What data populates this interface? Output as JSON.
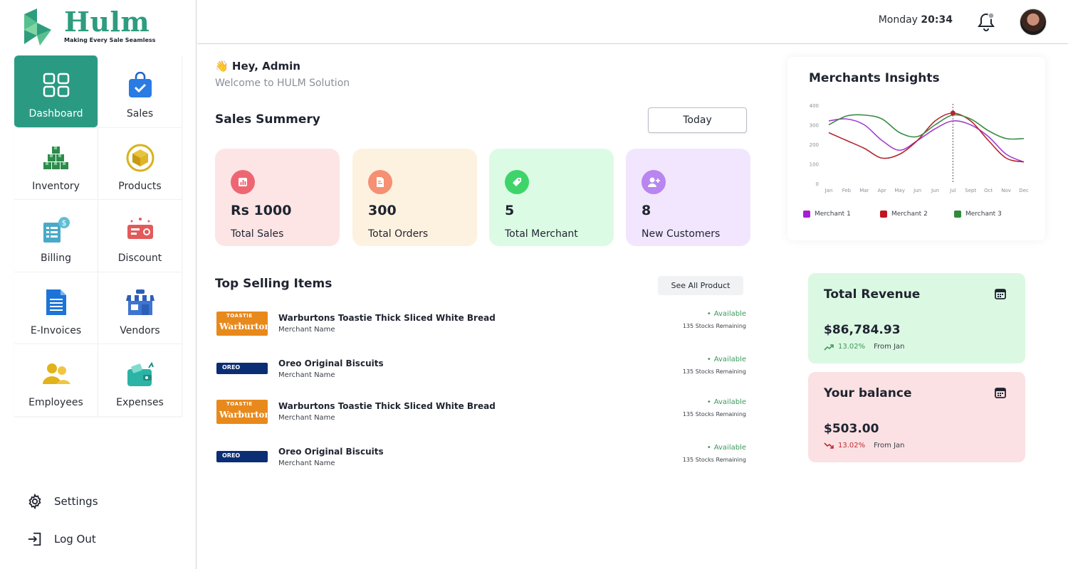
{
  "brand": {
    "name": "Hulm",
    "tagline": "Making Every Sale Seamless",
    "color": "#2d9c7f"
  },
  "sidebar": {
    "items": [
      {
        "label": "Dashboard",
        "icon": "dashboard-grid-icon",
        "active": true
      },
      {
        "label": "Sales",
        "icon": "shopping-bag-icon"
      },
      {
        "label": "Inventory",
        "icon": "boxes-icon"
      },
      {
        "label": "Products",
        "icon": "product-box-icon"
      },
      {
        "label": "Billing",
        "icon": "billing-receipt-icon"
      },
      {
        "label": "Discount",
        "icon": "discount-ticket-icon"
      },
      {
        "label": "E-Invoices",
        "icon": "document-icon"
      },
      {
        "label": "Vendors",
        "icon": "store-icon"
      },
      {
        "label": "Employees",
        "icon": "people-icon"
      },
      {
        "label": "Expenses",
        "icon": "wallet-icon"
      }
    ],
    "settings_label": "Settings",
    "logout_label": "Log Out"
  },
  "header": {
    "day": "Monday",
    "time": "20:34"
  },
  "greeting": {
    "title": "Hey, Admin",
    "emoji": "👋",
    "subtitle": "Welcome to HULM Solution"
  },
  "sales_summary": {
    "title": "Sales Summery",
    "period": "Today",
    "cards": [
      {
        "value": "Rs 1000",
        "caption": "Total Sales",
        "bg": "#fde5e6",
        "badge": "#ef6673",
        "icon": "chart-icon"
      },
      {
        "value": "300",
        "caption": "Total Orders",
        "bg": "#fdf2e0",
        "badge": "#f59073",
        "icon": "order-doc-icon"
      },
      {
        "value": "5",
        "caption": "Total Merchant",
        "bg": "#dcfbe4",
        "badge": "#3ed46a",
        "icon": "tag-icon"
      },
      {
        "value": "8",
        "caption": "New Customers",
        "bg": "#f1e6fd",
        "badge": "#b985f0",
        "icon": "add-user-icon"
      }
    ]
  },
  "top_selling": {
    "title": "Top Selling Items",
    "see_all": "See All Product",
    "items": [
      {
        "name": "Warburtons Toastie Thick Sliced White Bread",
        "merchant": "Merchant Name",
        "status": "Available",
        "stock": "135 Stocks Remaining",
        "thumb": "toastie",
        "thumb_top": "TOASTIE",
        "thumb_brand": "Warburtons"
      },
      {
        "name": "Oreo Original Biscuits",
        "merchant": "Merchant Name",
        "status": "Available",
        "stock": "135 Stocks Remaining",
        "thumb": "oreo",
        "thumb_brand": "OREO"
      },
      {
        "name": "Warburtons Toastie Thick Sliced White Bread",
        "merchant": "Merchant Name",
        "status": "Available",
        "stock": "135 Stocks Remaining",
        "thumb": "toastie",
        "thumb_top": "TOASTIE",
        "thumb_brand": "Warburtons"
      },
      {
        "name": "Oreo Original Biscuits",
        "merchant": "Merchant Name",
        "status": "Available",
        "stock": "135 Stocks Remaining",
        "thumb": "oreo",
        "thumb_brand": "OREO"
      }
    ]
  },
  "insights": {
    "title": "Merchants Insights",
    "legend": [
      "Merchant 1",
      "Merchant 2",
      "Merchant 3"
    ]
  },
  "chart_data": {
    "type": "line",
    "title": "Merchants Insights",
    "categories": [
      "Jan",
      "Feb",
      "Mar",
      "Apr",
      "May",
      "Jun",
      "Jun",
      "Jul",
      "Sept",
      "Oct",
      "Nov",
      "Dec"
    ],
    "ylim": [
      0,
      400
    ],
    "yticks": [
      0,
      100,
      200,
      300,
      400
    ],
    "grid": false,
    "legend_position": "bottom",
    "highlight_index": 7,
    "series": [
      {
        "name": "Merchant 1",
        "color": "#a23fd0",
        "values": [
          320,
          330,
          300,
          220,
          170,
          220,
          280,
          320,
          300,
          240,
          150,
          110
        ]
      },
      {
        "name": "Merchant 2",
        "color": "#b4252c",
        "values": [
          260,
          220,
          180,
          130,
          150,
          220,
          320,
          360,
          320,
          220,
          130,
          110
        ]
      },
      {
        "name": "Merchant 3",
        "color": "#3c8c46",
        "values": [
          300,
          345,
          350,
          330,
          260,
          240,
          300,
          350,
          330,
          270,
          230,
          230
        ]
      }
    ]
  },
  "revenue": {
    "title": "Total Revenue",
    "amount": "$86,784.93",
    "change": "13.02%",
    "from": "From Jan",
    "bg": "#dbf8e2",
    "change_color": "#3b9a5b"
  },
  "balance": {
    "title": "Your balance",
    "amount": "$503.00",
    "change": "13.02%",
    "from": "From Jan",
    "bg": "#fbe1e3",
    "change_color": "#c0292f"
  }
}
